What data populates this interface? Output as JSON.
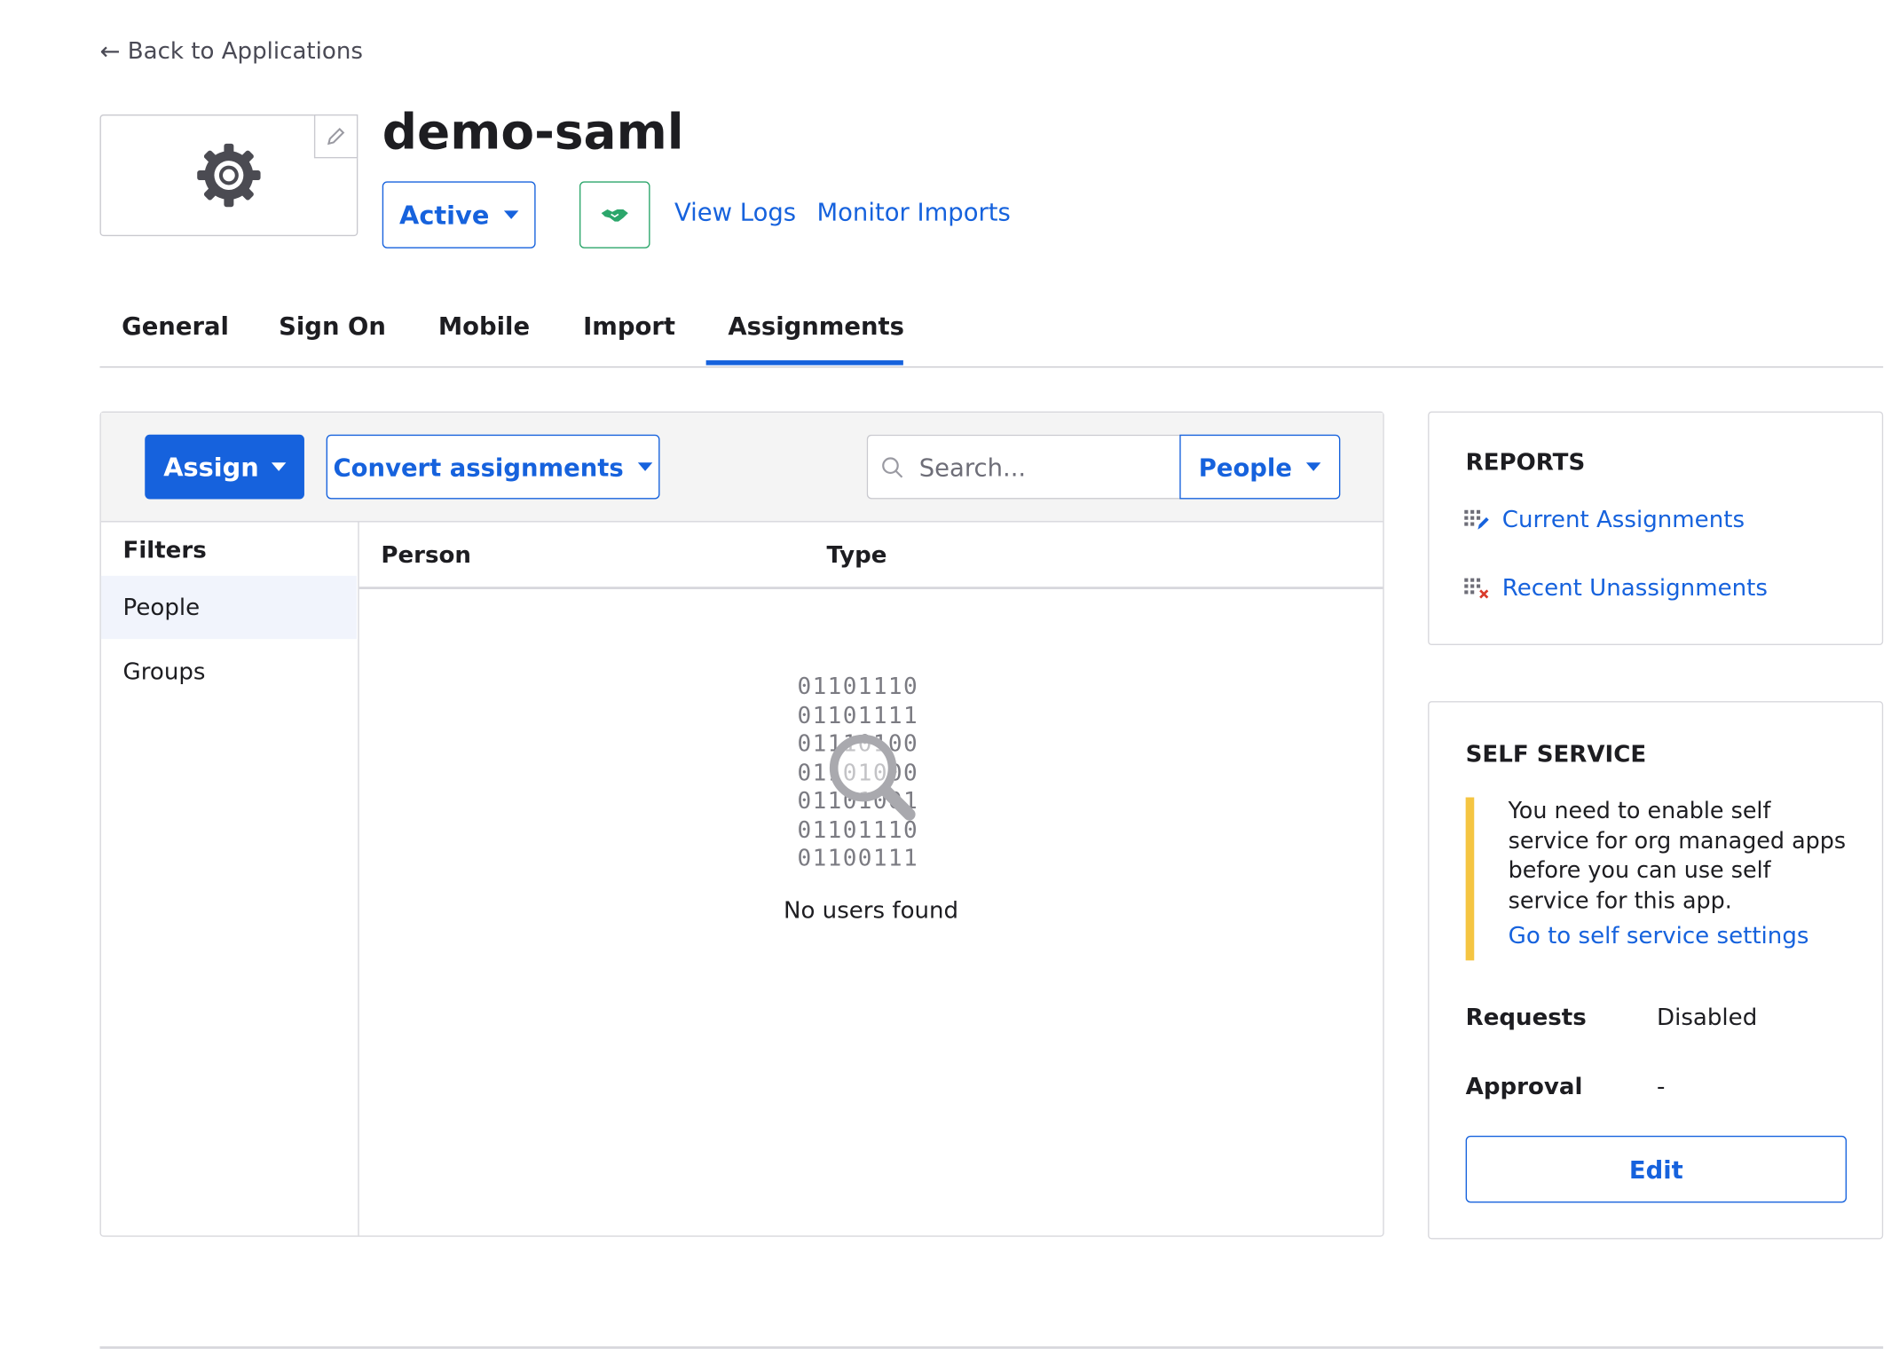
{
  "nav": {
    "back_label": "Back to Applications"
  },
  "app": {
    "title": "demo-saml",
    "status": "Active",
    "links": {
      "view_logs": "View Logs",
      "monitor_imports": "Monitor Imports"
    }
  },
  "tabs": [
    {
      "label": "General"
    },
    {
      "label": "Sign On"
    },
    {
      "label": "Mobile"
    },
    {
      "label": "Import"
    },
    {
      "label": "Assignments",
      "active": true
    }
  ],
  "toolbar": {
    "assign_label": "Assign",
    "convert_label": "Convert assignments",
    "search_placeholder": "Search...",
    "search_value": "",
    "filter_select": "People"
  },
  "filters": {
    "heading": "Filters",
    "items": [
      {
        "label": "People",
        "active": true
      },
      {
        "label": "Groups"
      }
    ]
  },
  "table": {
    "columns": [
      "Person",
      "Type"
    ],
    "empty": {
      "binary_lines": [
        "01101110",
        "01101111",
        "01110100",
        "01101000",
        "01101001",
        "01101110",
        "01100111"
      ],
      "message": "No users found"
    }
  },
  "reports": {
    "heading": "REPORTS",
    "links": [
      {
        "label": "Current Assignments",
        "icon": "report-edit-icon"
      },
      {
        "label": "Recent Unassignments",
        "icon": "report-remove-icon"
      }
    ]
  },
  "self_service": {
    "heading": "SELF SERVICE",
    "notice": "You need to enable self service for org managed apps before you can use self service for this app.",
    "notice_link": "Go to self service settings",
    "rows": [
      {
        "label": "Requests",
        "value": "Disabled"
      },
      {
        "label": "Approval",
        "value": "-"
      }
    ],
    "edit_label": "Edit"
  },
  "colors": {
    "primary": "#1662dd",
    "success": "#2ca66b",
    "warning": "#f5c542",
    "border": "#d7d7dc"
  }
}
